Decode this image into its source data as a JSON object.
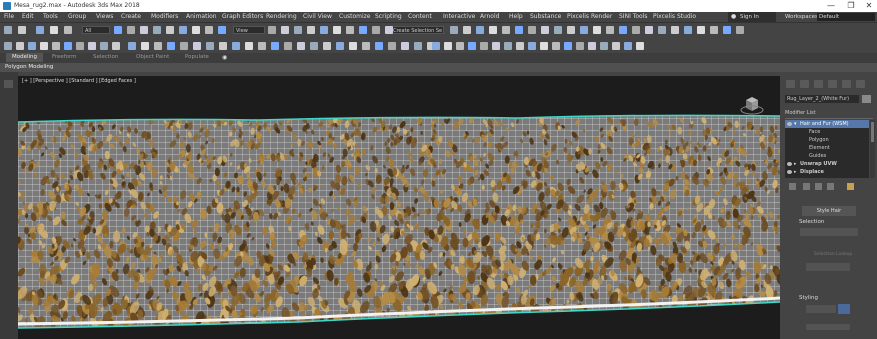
{
  "window": {
    "title": "Mesa_rug2.max - Autodesk 3ds Max 2018",
    "controls": [
      "—",
      "❐",
      "✕"
    ]
  },
  "menu": [
    "File",
    "Edit",
    "Tools",
    "Group",
    "Views",
    "Create",
    "Modifiers",
    "Animation",
    "Graph Editors",
    "Rendering",
    "Civil View",
    "Customize",
    "Scripting",
    "Content",
    "Interactive",
    "Arnold",
    "Help",
    "Substance",
    "Pixcelis Render",
    "SINI Tools",
    "Pixcelis Studio"
  ],
  "account": {
    "signin_label": "Sign In"
  },
  "workspace": {
    "label": "Workspaces:",
    "value": "Default"
  },
  "toolbar": {
    "selection_filter": "All",
    "ref_coord": "View",
    "named_selection": "Create Selection Se"
  },
  "ribbon": {
    "tabs": [
      "Modeling",
      "Freeform",
      "Selection",
      "Object Paint",
      "Populate"
    ],
    "active_tab": "Modeling",
    "panel_label": "Polygon Modeling"
  },
  "viewport": {
    "label": "[+ ] [Perspective ] [Standard ] [Edged Faces ]"
  },
  "command_panel": {
    "object_name": "Rug_Layer_2_(White Fur)",
    "modifier_list_label": "Modifier List",
    "modifiers": [
      {
        "label": "Hair and Fur (WSM)",
        "level": 0,
        "selected": true
      },
      {
        "label": "Face",
        "level": 1
      },
      {
        "label": "Polygon",
        "level": 1
      },
      {
        "label": "Element",
        "level": 1
      },
      {
        "label": "Guides",
        "level": 1
      },
      {
        "label": "Unwrap UVW",
        "level": 0,
        "bold": true
      },
      {
        "label": "Displace",
        "level": 0,
        "bold": true
      }
    ],
    "style_hair_label": "Style Hair",
    "selection_label": "Selection",
    "styling_label": "Styling",
    "selection_lookup_label": "Selection Lookup"
  },
  "colors": {
    "accent": "#2a7db5",
    "viewport_bg": "#1c1c1c",
    "selected_modifier": "#5577aa",
    "edge_cyan": "#40d8c8"
  }
}
